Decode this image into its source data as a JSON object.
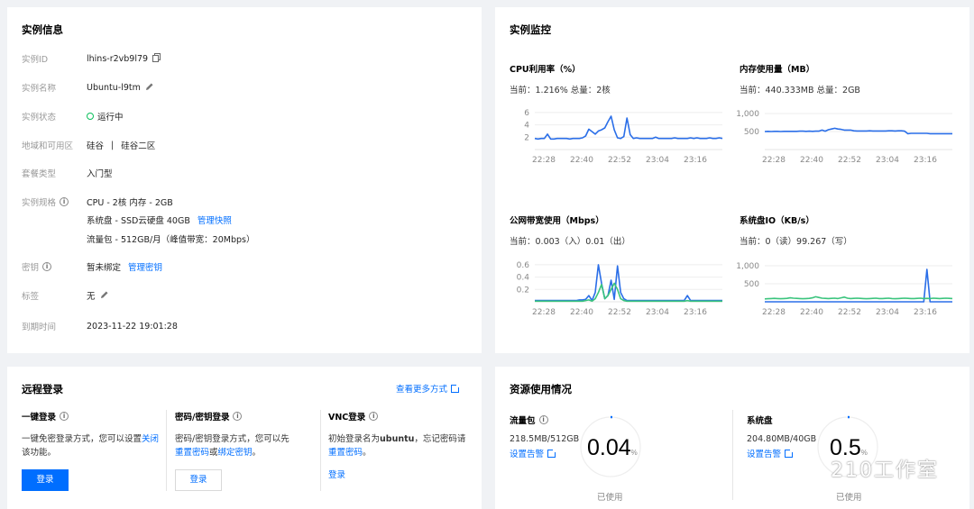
{
  "instance_info": {
    "title": "实例信息",
    "rows": [
      {
        "label": "实例ID",
        "value": "lhins-r2vb9l79"
      },
      {
        "label": "实例名称",
        "value": "Ubuntu-l9tm"
      },
      {
        "label": "实例状态",
        "value": "运行中"
      },
      {
        "label": "地域和可用区",
        "region": "硅谷",
        "divider": "|",
        "zone": "硅谷二区"
      },
      {
        "label": "套餐类型",
        "value": "入门型"
      },
      {
        "label": "实例规格",
        "spec1": "CPU - 2核 内存 - 2GB",
        "spec2": "系统盘 - SSD云硬盘 40GB",
        "spec2_link": "管理快照",
        "spec3": "流量包 - 512GB/月（峰值带宽：20Mbps）"
      },
      {
        "label": "密钥",
        "value": "暂未绑定",
        "link": "管理密钥"
      },
      {
        "label": "标签",
        "value": "无"
      },
      {
        "label": "到期时间",
        "value": "2023-11-22 19:01:28"
      }
    ],
    "status_color": "#0abf5b"
  },
  "monitor": {
    "title": "实例监控",
    "charts": [
      {
        "title": "CPU利用率（%）",
        "subtitle": "当前：1.216% 总量：2核"
      },
      {
        "title": "内存使用量（MB）",
        "subtitle": "当前：440.333MB 总量：2GB"
      },
      {
        "title": "公网带宽使用（Mbps）",
        "subtitle": "当前：0.003（入）0.01（出）"
      },
      {
        "title": "系统盘IO（KB/s）",
        "subtitle": "当前：0（读）99.267（写）"
      }
    ]
  },
  "chart_data": [
    {
      "type": "line",
      "x_ticks": [
        "22:28",
        "22:40",
        "22:52",
        "23:04",
        "23:16"
      ],
      "y_ticks": [
        "6",
        "4",
        "2"
      ],
      "ylim": [
        0,
        7
      ],
      "series": [
        {
          "color": "#2a6ee8",
          "values": [
            1.8,
            1.7,
            1.8,
            1.8,
            2.5,
            1.7,
            1.7,
            1.8,
            1.8,
            1.8,
            1.8,
            1.7,
            1.8,
            1.8,
            1.8,
            1.9,
            2.2,
            3.3,
            2.9,
            2.5,
            3.0,
            3.2,
            3.5,
            4.5,
            5.4,
            3.2,
            1.9,
            1.8,
            2.1,
            5.1,
            2.4,
            1.8,
            1.9,
            1.8,
            1.8,
            1.8,
            1.8,
            1.8,
            2.0,
            1.8,
            1.8,
            1.8,
            1.8,
            1.8,
            1.9,
            1.8,
            1.8,
            1.8,
            1.8,
            1.9,
            1.8,
            1.9,
            1.8,
            1.8,
            1.8,
            1.9,
            1.8,
            1.8,
            1.9,
            1.8
          ]
        }
      ]
    },
    {
      "type": "line",
      "x_ticks": [
        "22:28",
        "22:40",
        "22:52",
        "23:04",
        "23:16"
      ],
      "y_ticks": [
        "1,000",
        "500"
      ],
      "ylim": [
        0,
        1200
      ],
      "series": [
        {
          "color": "#2a6ee8",
          "values": [
            500,
            505,
            500,
            505,
            505,
            500,
            505,
            505,
            505,
            505,
            505,
            510,
            510,
            505,
            510,
            505,
            510,
            510,
            540,
            510,
            550,
            570,
            590,
            570,
            560,
            540,
            540,
            540,
            520,
            515,
            515,
            515,
            515,
            520,
            515,
            515,
            515,
            515,
            515,
            520,
            520,
            515,
            520,
            520,
            510,
            440,
            450,
            450,
            450,
            450,
            450,
            450,
            440,
            440,
            440,
            440,
            440,
            440,
            440,
            440
          ]
        }
      ]
    },
    {
      "type": "line",
      "x_ticks": [
        "22:28",
        "22:40",
        "22:52",
        "23:04",
        "23:16"
      ],
      "y_ticks": [
        "0.6",
        "0.4",
        "0.2"
      ],
      "ylim": [
        0,
        0.7
      ],
      "series": [
        {
          "color": "#2a6ee8",
          "values": [
            0.02,
            0.02,
            0.02,
            0.02,
            0.02,
            0.02,
            0.02,
            0.02,
            0.02,
            0.02,
            0.02,
            0.02,
            0.02,
            0.02,
            0.03,
            0.03,
            0.04,
            0.1,
            0.02,
            0.15,
            0.6,
            0.3,
            0.05,
            0.1,
            0.35,
            0.04,
            0.58,
            0.15,
            0.05,
            0.02,
            0.02,
            0.02,
            0.02,
            0.02,
            0.02,
            0.02,
            0.02,
            0.02,
            0.02,
            0.02,
            0.02,
            0.02,
            0.02,
            0.02,
            0.02,
            0.02,
            0.02,
            0.02,
            0.1,
            0.02,
            0.02,
            0.02,
            0.02,
            0.02,
            0.02,
            0.02,
            0.02,
            0.02,
            0.02,
            0.02
          ]
        },
        {
          "color": "#3ac47d",
          "values": [
            0.01,
            0.01,
            0.01,
            0.01,
            0.01,
            0.01,
            0.01,
            0.01,
            0.01,
            0.01,
            0.01,
            0.01,
            0.01,
            0.01,
            0.01,
            0.01,
            0.02,
            0.03,
            0.01,
            0.05,
            0.15,
            0.28,
            0.05,
            0.1,
            0.2,
            0.3,
            0.2,
            0.05,
            0.02,
            0.01,
            0.01,
            0.01,
            0.01,
            0.01,
            0.01,
            0.01,
            0.01,
            0.01,
            0.01,
            0.01,
            0.01,
            0.01,
            0.01,
            0.01,
            0.01,
            0.01,
            0.01,
            0.01,
            0.02,
            0.01,
            0.01,
            0.01,
            0.01,
            0.01,
            0.01,
            0.01,
            0.01,
            0.01,
            0.01,
            0.01
          ]
        }
      ]
    },
    {
      "type": "line",
      "x_ticks": [
        "22:28",
        "22:40",
        "22:52",
        "23:04",
        "23:16"
      ],
      "y_ticks": [
        "1,000",
        "500"
      ],
      "ylim": [
        0,
        1200
      ],
      "series": [
        {
          "color": "#2a6ee8",
          "values": [
            0,
            0,
            0,
            0,
            0,
            0,
            0,
            0,
            0,
            0,
            0,
            0,
            0,
            0,
            0,
            0,
            0,
            0,
            0,
            0,
            0,
            0,
            0,
            0,
            0,
            0,
            0,
            0,
            0,
            0,
            0,
            0,
            0,
            0,
            0,
            0,
            0,
            0,
            0,
            0,
            0,
            0,
            0,
            0,
            0,
            0,
            0,
            0,
            0,
            0,
            0,
            900,
            0,
            0,
            0,
            0,
            0,
            0,
            0,
            0
          ]
        },
        {
          "color": "#3ac47d",
          "values": [
            80,
            85,
            90,
            95,
            90,
            85,
            90,
            95,
            110,
            100,
            95,
            90,
            85,
            90,
            95,
            110,
            140,
            120,
            100,
            95,
            90,
            95,
            100,
            90,
            110,
            130,
            100,
            90,
            95,
            100,
            95,
            90,
            85,
            90,
            95,
            100,
            90,
            90,
            95,
            100,
            90,
            85,
            90,
            95,
            100,
            95,
            90,
            90,
            95,
            100,
            90,
            95,
            90,
            100,
            95,
            90,
            95,
            100,
            95,
            90
          ]
        }
      ]
    }
  ],
  "remote_login": {
    "title": "远程登录",
    "more_link": "查看更多方式",
    "cols": [
      {
        "title": "一键登录",
        "desc1": "一键免密登录方式，您可以设置",
        "desc1_link": "关闭",
        "desc2": "该功能。",
        "button": "登录"
      },
      {
        "title": "密码/密钥登录",
        "desc1": "密码/密钥登录方式，您可以先",
        "link_a": "重置密码",
        "mid": "或",
        "link_b": "绑定密钥",
        "end": "。",
        "button": "登录"
      },
      {
        "title": "VNC登录",
        "desc1_a": "初始登录名为",
        "desc1_b": "ubuntu",
        "desc1_c": "，忘记密码请",
        "link": "重置密码",
        "end": "。",
        "button": "登录"
      }
    ]
  },
  "resources": {
    "title": "资源使用情况",
    "items": [
      {
        "title": "流量包",
        "value": "218.5MB/512GB",
        "link": "设置告警",
        "gauge": "0.04",
        "gauge_unit": "%",
        "caption": "已使用",
        "fraction": 0.0004
      },
      {
        "title": "系统盘",
        "value": "204.80MB/40GB",
        "link": "设置告警",
        "gauge": "0.5",
        "gauge_unit": "%",
        "caption": "已使用",
        "fraction": 0.005
      }
    ]
  },
  "watermark": "210工作室"
}
